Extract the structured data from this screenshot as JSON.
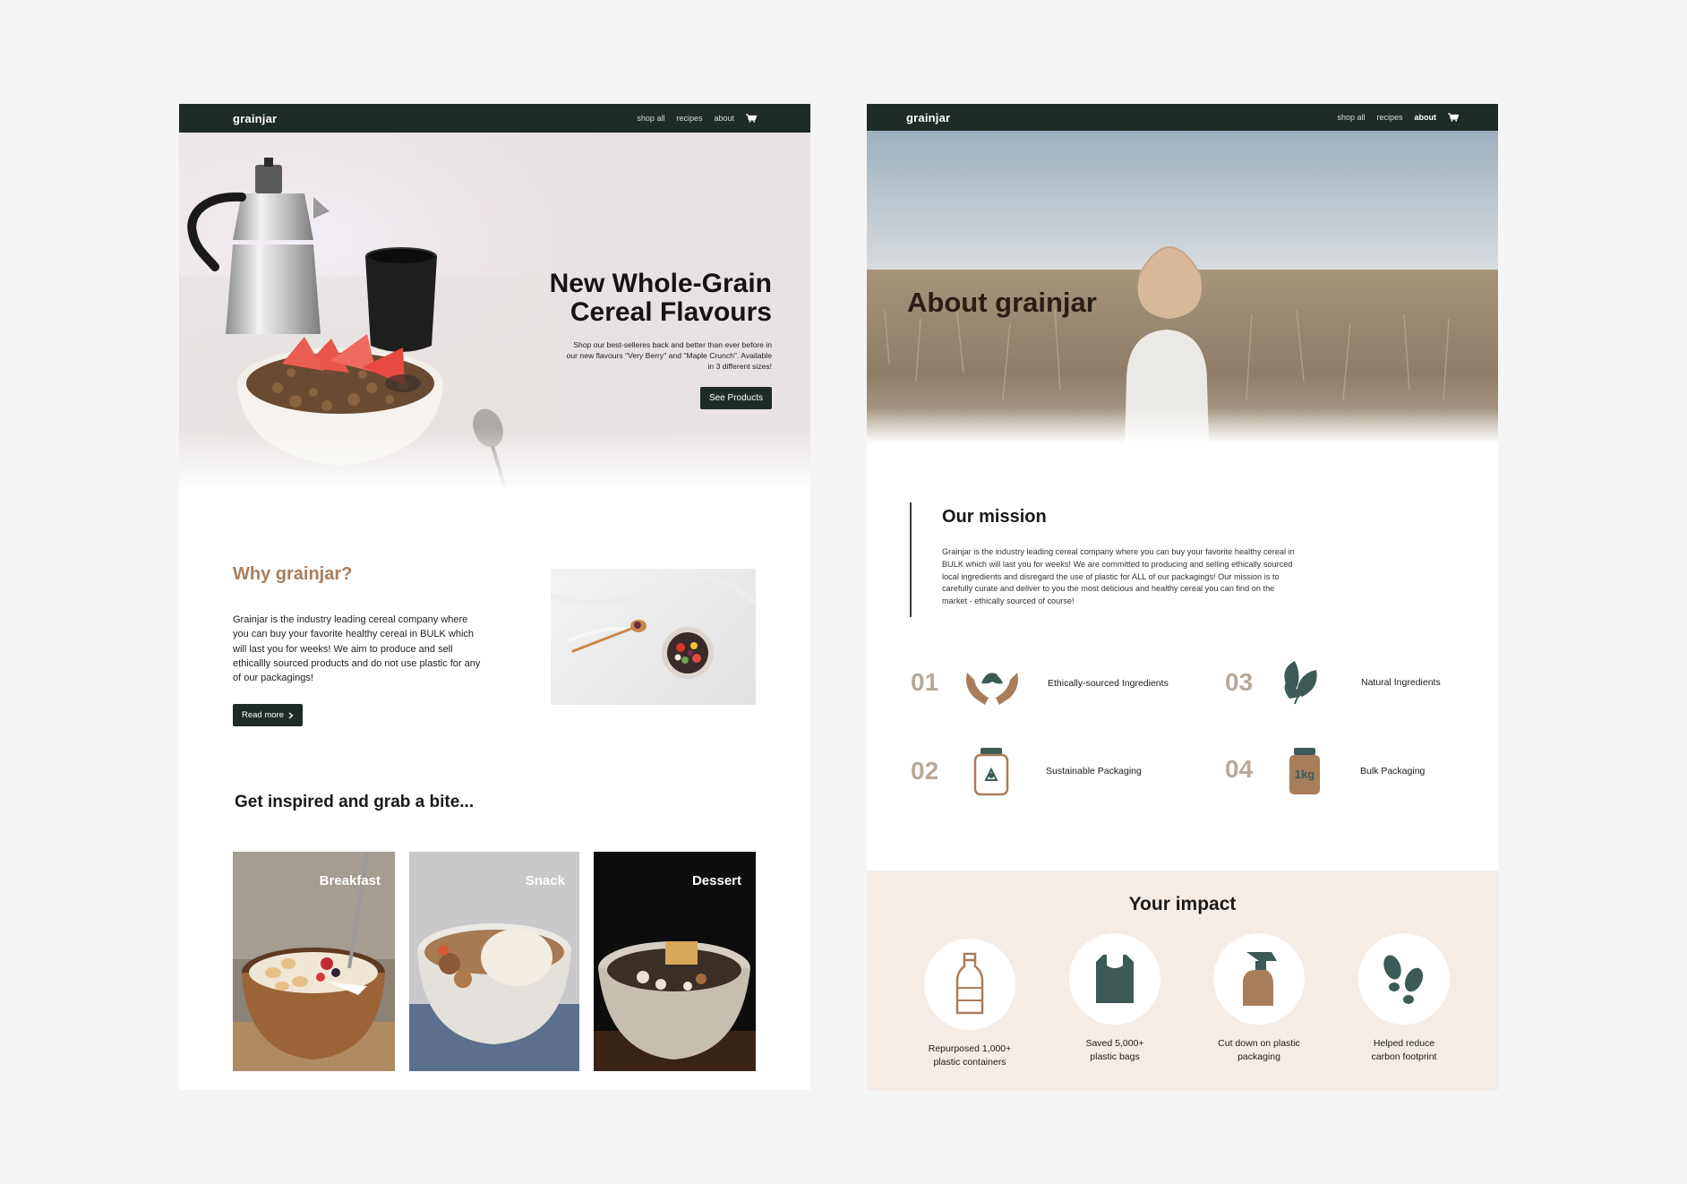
{
  "home": {
    "nav": {
      "logo": "grainjar",
      "links": [
        "shop all",
        "recipes",
        "about"
      ]
    },
    "hero": {
      "title_line1": "New Whole-Grain",
      "title_line2": "Cereal Flavours",
      "text": "Shop our best-selleres back and better than ever before in our new flavours \"Very Berry\" and \"Maple Crunch\".  Available in 3 different sizes!",
      "button": "See Products"
    },
    "why": {
      "title": "Why grainjar?",
      "text": "Grainjar is the industry leading cereal company where you can buy your favorite healthy cereal in BULK which will last you for weeks! We aim to produce and sell ethicallly sourced products and do not use plastic for any of our packagings!",
      "button": "Read more"
    },
    "inspire_title": "Get inspired and grab a bite...",
    "cards": [
      "Breakfast",
      "Snack",
      "Dessert"
    ]
  },
  "about": {
    "nav": {
      "logo": "grainjar",
      "links": [
        "shop all",
        "recipes",
        "about"
      ],
      "active": "about"
    },
    "hero_title": "About grainjar",
    "mission": {
      "title": "Our mission",
      "text": "Grainjar is the industry leading cereal company where you can buy your favorite healthy cereal in BULK which will last you for weeks! We are committed to producing and selling ethically sourced local ingredients and disregard the use of plastic for ALL of our packagings! Our mission is to carefully curate and deliver to you the most delicious and healthy cereal you can find on the market - ethically sourced of course!"
    },
    "features": [
      {
        "num": "01",
        "label": "Ethically-sourced Ingredients",
        "icon": "hands-leaf-icon"
      },
      {
        "num": "02",
        "label": "Sustainable Packaging",
        "icon": "recycle-jar-icon"
      },
      {
        "num": "03",
        "label": "Natural Ingredients",
        "icon": "leaves-icon"
      },
      {
        "num": "04",
        "label": "Bulk Packaging",
        "icon": "bulk-jar-icon",
        "jar_text": "1kg"
      }
    ],
    "impact": {
      "title": "Your impact",
      "items": [
        {
          "label": "Repurposed 1,000+\nplastic containers",
          "icon": "bottle-icon"
        },
        {
          "label": "Saved 5,000+\nplastic bags",
          "icon": "plastic-bag-icon"
        },
        {
          "label": "Cut down on plastic\npackaging",
          "icon": "spray-bottle-icon"
        },
        {
          "label": "Helped reduce\ncarbon footprint",
          "icon": "footprints-icon"
        }
      ]
    }
  },
  "colors": {
    "dark": "#1f2b27",
    "brown": "#a87d5b",
    "teal": "#3d5a56",
    "impact_bg": "#f5ece6"
  }
}
